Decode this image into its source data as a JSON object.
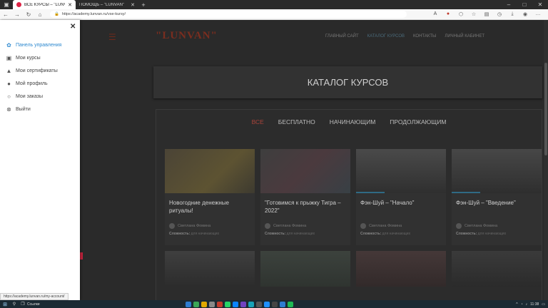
{
  "browser": {
    "tabs": [
      {
        "label": "ВСЕ КУРСЫ – \"LUNVAN\"",
        "active": true
      },
      {
        "label": "ПОМОЩЬ – \"LUNVAN\"",
        "active": false
      }
    ],
    "url": "https://academy.lunvan.ru/vse-kursy/",
    "status_link": "https://academy.lunvan.ru/my-account/"
  },
  "site": {
    "logo": "\"LUNVAN\"",
    "nav": [
      "ГЛАВНЫЙ САЙТ",
      "КАТАЛОГ КУРСОВ",
      "КОНТАКТЫ",
      "ЛИЧНЫЙ КАБИНЕТ"
    ],
    "catalog_title": "КАТАЛОГ КУРСОВ",
    "filters": [
      "ВСЕ",
      "БЕСПЛАТНО",
      "НАЧИНАЮЩИМ",
      "ПРОДОЛЖАЮЩИМ"
    ],
    "courses": [
      {
        "title": "Новогодние денежные ритуалы!",
        "author": "Светлана Фомина",
        "difficulty_label": "Сложность:",
        "difficulty": "для начинающих"
      },
      {
        "title": "\"Готовимся к прыжку Тигра – 2022\"",
        "author": "Светлана Фомина",
        "difficulty_label": "Сложность:",
        "difficulty": "для начинающих"
      },
      {
        "title": "Фэн-Шуй – \"Начало\"",
        "author": "Светлана Фомина",
        "difficulty_label": "Сложность:",
        "difficulty": "для начинающих"
      },
      {
        "title": "Фэн-Шуй – \"Введение\"",
        "author": "Светлана Фомина",
        "difficulty_label": "Сложность:",
        "difficulty": "для начинающих"
      }
    ]
  },
  "sidebar": {
    "items": [
      {
        "label": "Панель управления",
        "icon": "gauge-icon",
        "active": true
      },
      {
        "label": "Мои курсы",
        "icon": "courses-icon",
        "active": false
      },
      {
        "label": "Мои сертификаты",
        "icon": "graduation-cap-icon",
        "active": false
      },
      {
        "label": "Мой профиль",
        "icon": "user-icon",
        "active": false
      },
      {
        "label": "Мои заказы",
        "icon": "orders-icon",
        "active": false
      },
      {
        "label": "Выйти",
        "icon": "logout-icon",
        "active": false
      }
    ]
  },
  "taskbar": {
    "search_label": "Ссылки",
    "time": "11:38"
  }
}
